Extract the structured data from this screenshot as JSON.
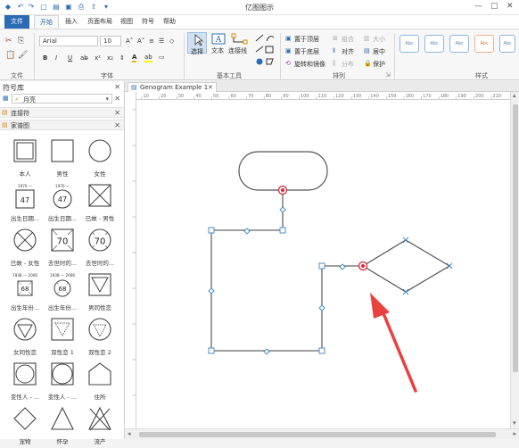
{
  "title_bar": {
    "app_title": "亿图图示"
  },
  "menu_tabs": [
    "文件",
    "开始",
    "插入",
    "页面布局",
    "视图",
    "符号",
    "帮助"
  ],
  "ribbon": {
    "font": {
      "family": "Arial",
      "size": "10",
      "label": "字体",
      "bold": "B",
      "italic": "I",
      "underline": "U",
      "grow": "A˄",
      "shrink": "A˅",
      "align": "≡",
      "bullets": "☰",
      "clear": "◇"
    },
    "file_group_label": "文件",
    "basic_tools": {
      "select": "选择",
      "text": "文本",
      "connector": "连接线",
      "label": "基本工具"
    },
    "arrange": {
      "bring_front": "置于顶层",
      "send_back": "置于底层",
      "rotate_mirror": "旋转和镜像",
      "group": "组合",
      "align": "对齐",
      "distribute": "分布",
      "size": "大小",
      "center": "居中",
      "protect": "保护",
      "label": "排列"
    },
    "styles": {
      "label": "样式",
      "swatch_text": "Abc",
      "swatch_colors": [
        "#8fb7de",
        "#8fb7de",
        "#8fb7de",
        "#f4b183",
        "#8fb7de"
      ]
    }
  },
  "symbol_panel": {
    "title": "符号库",
    "search_value": "月亮",
    "sections": [
      "连接符",
      "家谱图"
    ],
    "shapes": [
      {
        "label": "本人",
        "icon": "square-double-icon"
      },
      {
        "label": "男性",
        "icon": "square-icon"
      },
      {
        "label": "女性",
        "icon": "circle-icon"
      },
      {
        "label": "出生日期...",
        "icon": "square-birthdate-icon",
        "top": "1970 —",
        "inner": "47"
      },
      {
        "label": "出生日期...",
        "icon": "circle-birthdate-icon",
        "top": "1970 —",
        "inner": "47"
      },
      {
        "label": "已故 - 男性",
        "icon": "square-x-icon"
      },
      {
        "label": "已故 - 女性",
        "icon": "circle-x-icon"
      },
      {
        "label": "去世时的...",
        "icon": "square-x-age-icon",
        "inner": "70"
      },
      {
        "label": "去世时的...",
        "icon": "circle-x-age-icon",
        "inner": "70"
      },
      {
        "label": "出生年份...",
        "icon": "square-lifespan-icon",
        "top": "1938 — 2006",
        "inner": "68"
      },
      {
        "label": "出生年份...",
        "icon": "circle-lifespan-icon",
        "top": "1938 — 2006",
        "inner": "68"
      },
      {
        "label": "男同性恋",
        "icon": "triangle-down-square-icon"
      },
      {
        "label": "女同性恋",
        "icon": "triangle-down-circle-icon"
      },
      {
        "label": "双性恋 1",
        "icon": "dotted-triangle-square-icon"
      },
      {
        "label": "双性恋 2",
        "icon": "dotted-triangle-circle-icon"
      },
      {
        "label": "变性人 - ...",
        "icon": "square-circle-icon"
      },
      {
        "label": "变性人 - ...",
        "icon": "circle-in-square-icon"
      },
      {
        "label": "住所",
        "icon": "house-icon"
      },
      {
        "label": "宠物",
        "icon": "diamond-icon"
      },
      {
        "label": "怀孕",
        "icon": "triangle-icon"
      },
      {
        "label": "流产",
        "icon": "triangle-x-icon"
      }
    ]
  },
  "document_tab": {
    "name": "Genogram Example 1"
  },
  "ruler": {
    "h_ticks": [
      "10",
      "20",
      "30",
      "40",
      "50",
      "60",
      "70",
      "80",
      "90",
      "100",
      "110",
      "120",
      "130",
      "140",
      "150",
      "160",
      "170",
      "180",
      "190",
      "200",
      "210"
    ]
  },
  "colors": {
    "accent": "#2b6bb3",
    "selected_handle": "#d9263a",
    "handle": "#3a86c8",
    "arrow": "#e8413e"
  }
}
